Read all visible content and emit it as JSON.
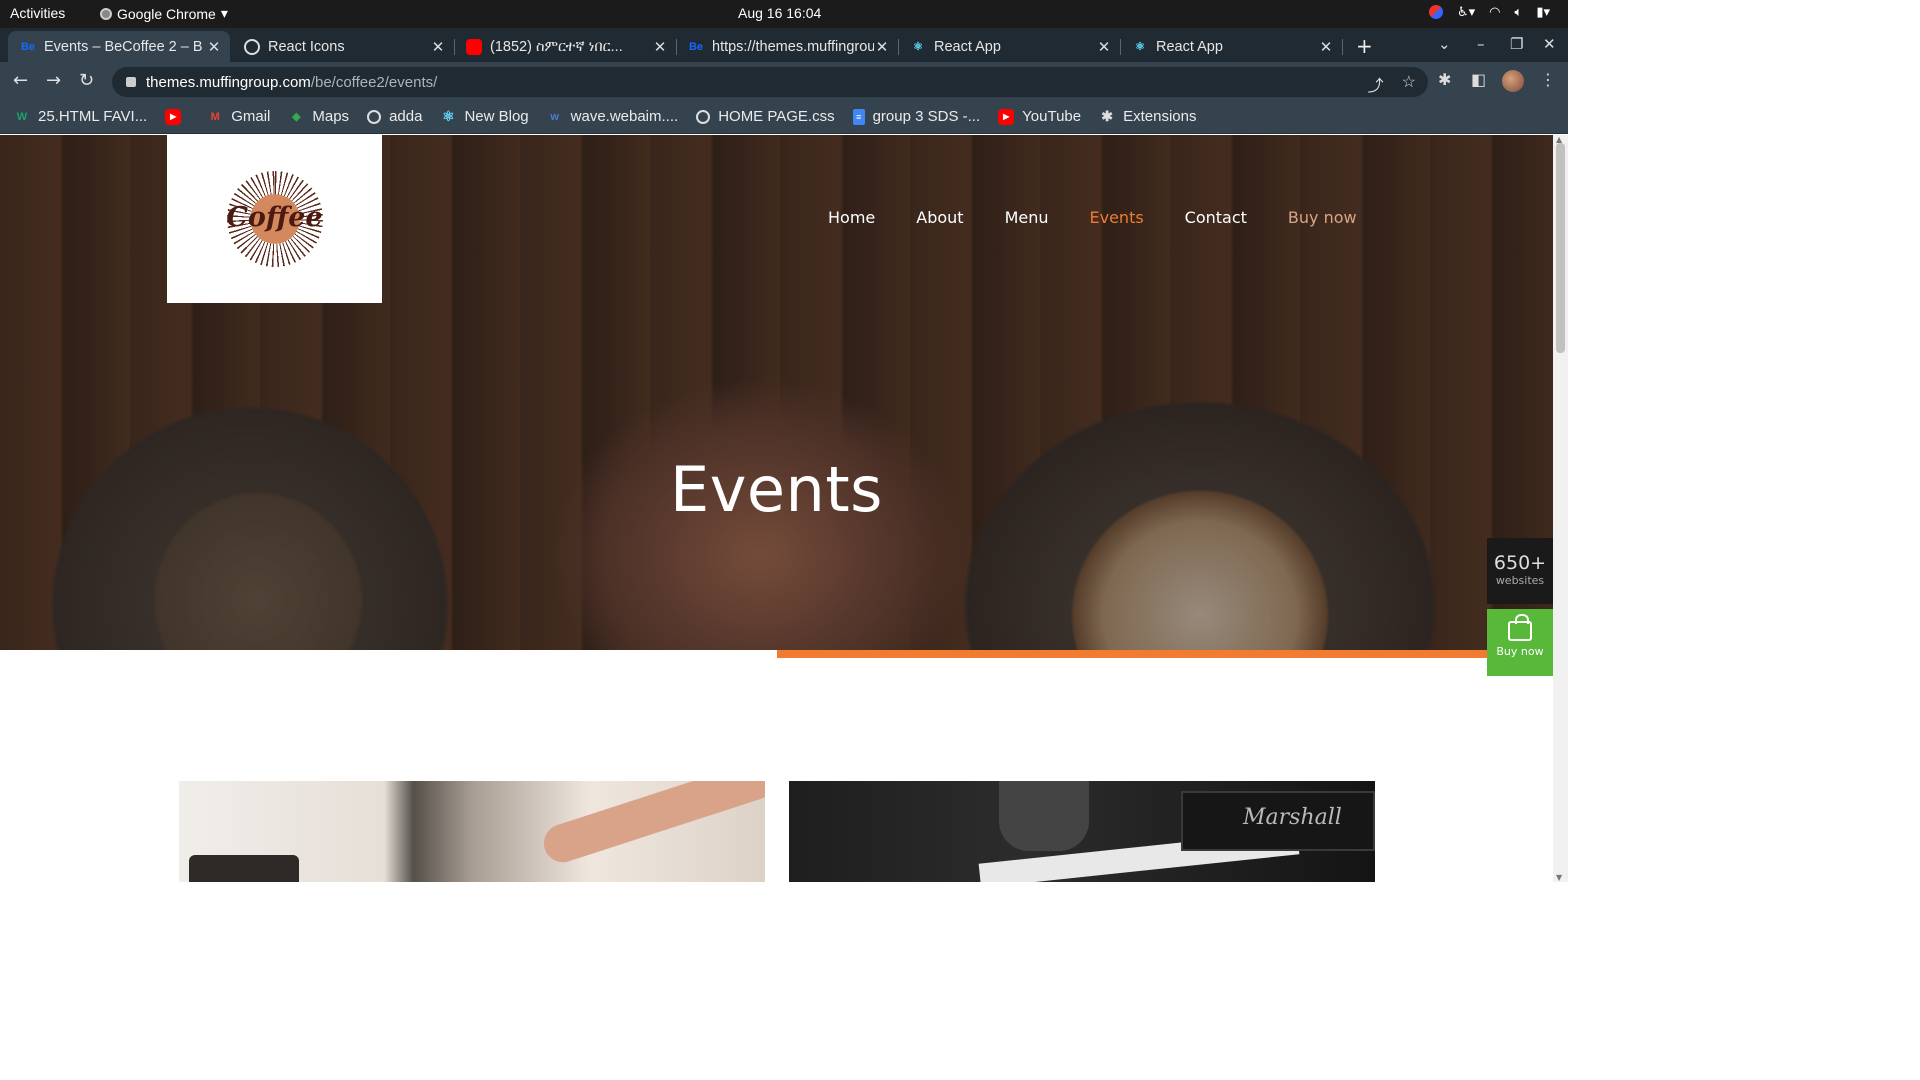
{
  "os": {
    "activities": "Activities",
    "app_name": "Google Chrome",
    "clock": "Aug 16  16:04"
  },
  "tabs": [
    {
      "title": "Events – BeCoffee 2 – B",
      "icon": "behance-icon",
      "active": true
    },
    {
      "title": "React Icons",
      "icon": "globe-icon"
    },
    {
      "title": "(1852) ስምርተኛ ነበር...",
      "icon": "youtube-icon"
    },
    {
      "title": "https://themes.muffingroup",
      "icon": "behance-icon"
    },
    {
      "title": "React App",
      "icon": "react-icon"
    },
    {
      "title": "React App",
      "icon": "react-icon"
    }
  ],
  "address": {
    "host": "themes.muffingroup.com",
    "path": "/be/coffee2/events/"
  },
  "bookmarks": [
    {
      "label": "25.HTML FAVI...",
      "icon": "w-icon",
      "color": "#1ca36b"
    },
    {
      "label": "",
      "icon": "youtube-icon",
      "color": "#ff0000"
    },
    {
      "label": "Gmail",
      "icon": "gmail-icon",
      "color": "#ea4335"
    },
    {
      "label": "Maps",
      "icon": "maps-icon",
      "color": "#34a853"
    },
    {
      "label": "adda",
      "icon": "globe-icon",
      "color": "#dddddd"
    },
    {
      "label": "New Blog",
      "icon": "react-icon",
      "color": "#61dafb"
    },
    {
      "label": "wave.webaim....",
      "icon": "wave-icon",
      "color": "#4a7bd3"
    },
    {
      "label": "HOME PAGE.css",
      "icon": "globe-icon",
      "color": "#dddddd"
    },
    {
      "label": "group 3 SDS -...",
      "icon": "docs-icon",
      "color": "#4285f4"
    },
    {
      "label": "YouTube",
      "icon": "youtube-icon",
      "color": "#ff0000"
    },
    {
      "label": "Extensions",
      "icon": "puzzle-icon",
      "color": "#dddddd"
    }
  ],
  "site": {
    "logo_text": "Coffee",
    "nav": [
      "Home",
      "About",
      "Menu",
      "Events",
      "Contact",
      "Buy now"
    ],
    "current": "Events",
    "hero_title": "Events",
    "amp_brand": "Marshall"
  },
  "widgets": {
    "count": "650+",
    "count_label": "websites",
    "buy_label": "Buy now"
  },
  "colors": {
    "accent": "#f07b31",
    "buy_green": "#57b83a"
  }
}
